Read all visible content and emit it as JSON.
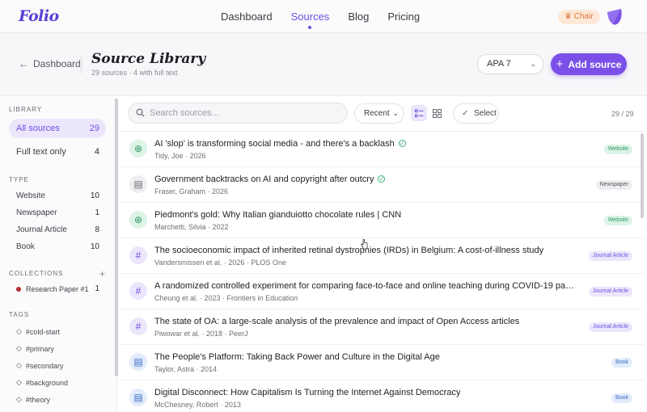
{
  "app": {
    "logo": "Folio",
    "nav": [
      "Dashboard",
      "Sources",
      "Blog",
      "Pricing"
    ],
    "active_nav": "Sources",
    "role_badge": "Chair",
    "accent_color": "#7a50e8"
  },
  "header": {
    "back_label": "Dashboard",
    "title": "Source Library",
    "subtitle": "29 sources · 4 with full text",
    "citation_style": "APA 7",
    "add_button": "Add source"
  },
  "sidebar": {
    "library_label": "LIBRARY",
    "library_items": [
      {
        "label": "All sources",
        "count": "29"
      },
      {
        "label": "Full text only",
        "count": "4"
      }
    ],
    "type_label": "TYPE",
    "type_items": [
      {
        "label": "Website",
        "count": "10"
      },
      {
        "label": "Newspaper",
        "count": "1"
      },
      {
        "label": "Journal Article",
        "count": "8"
      },
      {
        "label": "Book",
        "count": "10"
      }
    ],
    "collections_label": "COLLECTIONS",
    "collections": [
      {
        "label": "Research Paper #1",
        "count": "1",
        "color": "#b2302f"
      }
    ],
    "tags_label": "TAGS",
    "tags": [
      "#cold-start",
      "#primary",
      "#secondary",
      "#background",
      "#theory"
    ]
  },
  "toolbar": {
    "search_placeholder": "Search sources...",
    "sort": "Recent",
    "select_label": "Select",
    "pager": "29 / 29"
  },
  "sources": [
    {
      "title": "AI 'slop' is transforming social media - and there's a backlash",
      "meta": "Tidy, Joe · 2026",
      "type": "Website",
      "icon": "globe-icon",
      "full_text": true
    },
    {
      "title": "Government backtracks on AI and copyright after outcry",
      "meta": "Fraser, Graham · 2026",
      "type": "Newspaper",
      "icon": "document-icon",
      "full_text": true
    },
    {
      "title": "Piedmont's gold: Why Italian gianduiotto chocolate rules | CNN",
      "meta": "Marchetti, Silvia · 2022",
      "type": "Website",
      "icon": "globe-icon",
      "full_text": false
    },
    {
      "title": "The socioeconomic impact of inherited retinal dystrophies (IRDs) in Belgium: A cost-of-illness study",
      "meta": "Vandersmissen et al. · 2026 · PLOS One",
      "type": "Journal Article",
      "icon": "hash-icon",
      "full_text": false
    },
    {
      "title": "A randomized controlled experiment for comparing face-to-face and online teaching during COVID-19 pan...",
      "meta": "Cheung et al. · 2023 · Frontiers in Education",
      "type": "Journal Article",
      "icon": "hash-icon",
      "full_text": false
    },
    {
      "title": "The state of OA: a large-scale analysis of the prevalence and impact of Open Access articles",
      "meta": "Piwowar et al. · 2018 · PeerJ",
      "type": "Journal Article",
      "icon": "hash-icon",
      "full_text": false
    },
    {
      "title": "The People's Platform: Taking Back Power and Culture in the Digital Age",
      "meta": "Taylor, Astra · 2014",
      "type": "Book",
      "icon": "book-icon",
      "full_text": false
    },
    {
      "title": "Digital Disconnect: How Capitalism Is Turning the Internet Against Democracy",
      "meta": "McChesney, Robert · 2013",
      "type": "Book",
      "icon": "book-icon",
      "full_text": false
    }
  ]
}
